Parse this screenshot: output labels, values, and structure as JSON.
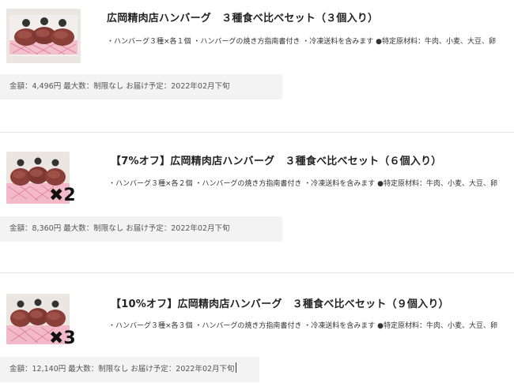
{
  "products": [
    {
      "title": "広岡精肉店ハンバーグ　３種食べ比べセット（３個入り）",
      "description": "・ハンバーグ３種×各１個 ・ハンバーグの焼き方指南書付き ・冷凍送料を含みます ●特定原材料：牛肉、小麦、大豆、卵",
      "info": "金額：4,496円 最大数：制限なし お届け予定：2022年02月下旬",
      "quantity_mark": ""
    },
    {
      "title": "【7%オフ】広岡精肉店ハンバーグ　３種食べ比べセット（６個入り）",
      "description": "・ハンバーグ３種×各２個 ・ハンバーグの焼き方指南書付き ・冷凍送料を含みます ●特定原材料：牛肉、小麦、大豆、卵",
      "info": "金額：8,360円 最大数：制限なし お届け予定：2022年02月下旬",
      "quantity_mark": "✖2"
    },
    {
      "title": "【10%オフ】広岡精肉店ハンバーグ　３種食べ比べセット（９個入り）",
      "description": "・ハンバーグ３種×各３個 ・ハンバーグの焼き方指南書付き ・冷凍送料を含みます ●特定原材料：牛肉、小麦、大豆、卵",
      "info": "金額：12,140円 最大数：制限なし お届け予定：2022年02月下旬",
      "quantity_mark": "✖3"
    }
  ]
}
